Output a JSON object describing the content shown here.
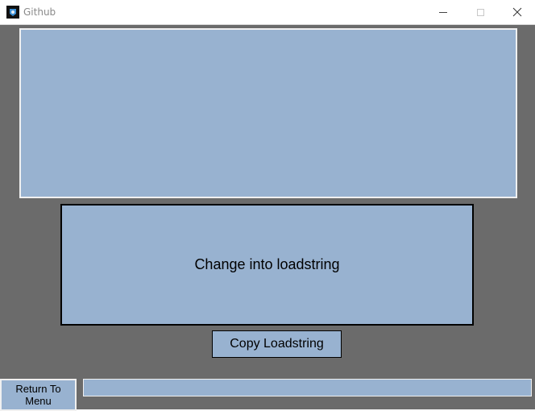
{
  "window": {
    "title": "Github",
    "icon": "github-app-icon"
  },
  "controls": {
    "minimize_icon": "minimize-icon",
    "maximize_icon": "maximize-icon",
    "close_icon": "close-icon"
  },
  "main": {
    "editor_value": "",
    "convert_label": "Change into loadstring",
    "copy_label": "Copy Loadstring",
    "return_label": "Return To Menu",
    "output_value": ""
  },
  "colors": {
    "background": "#6b6b6b",
    "panel": "#98b2d0"
  }
}
